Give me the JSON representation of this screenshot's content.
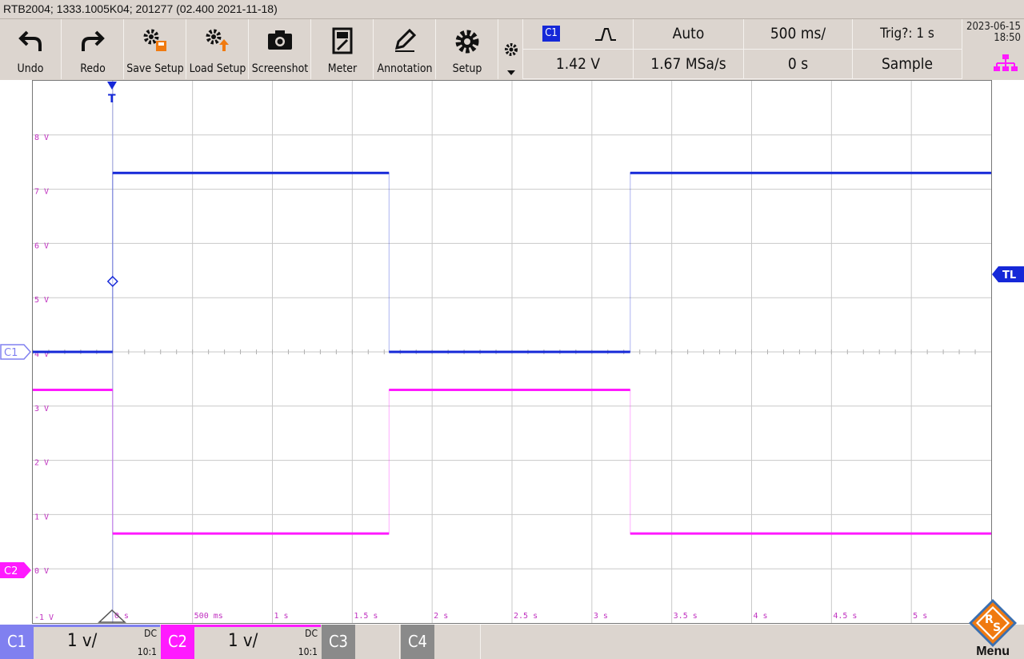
{
  "title": "RTB2004; 1333.1005K04; 201277 (02.400 2021-11-18)",
  "toolbar": {
    "undo": "Undo",
    "redo": "Redo",
    "save_setup": "Save Setup",
    "load_setup": "Load Setup",
    "screenshot": "Screenshot",
    "meter": "Meter",
    "annotation": "Annotation",
    "setup": "Setup"
  },
  "trigger": {
    "source": "C1",
    "level": "1.42 V",
    "mode": "Auto",
    "sample_rate": "1.67 MSa/s",
    "timebase": "500 ms/",
    "position": "0 s",
    "status": "Trig?: 1 s",
    "acquisition": "Sample"
  },
  "datetime": {
    "date": "2023-06-15",
    "time": "18:50"
  },
  "markers": {
    "trigger": "T",
    "trigger_level": "TL",
    "c1": "C1",
    "c2": "C2"
  },
  "colors": {
    "c1": "#1528d8",
    "c2": "#ff1aff",
    "grid": "#c9c9c9",
    "axis_label": "#c030c0",
    "c1_tag": "#8080f0"
  },
  "channels": [
    {
      "name": "C1",
      "scale": "1 v/",
      "coupling": "DC",
      "probe": "10:1",
      "active": true
    },
    {
      "name": "C2",
      "scale": "1 v/",
      "coupling": "DC",
      "probe": "10:1",
      "active": true
    },
    {
      "name": "C3",
      "active": false
    },
    {
      "name": "C4",
      "active": false
    }
  ],
  "menu_label": "Menu",
  "chart_data": {
    "type": "line",
    "x_tick_labels": [
      "0 s",
      "500 ms",
      "1 s",
      "1.5 s",
      "2 s",
      "2.5 s",
      "3 s",
      "3.5 s",
      "4 s",
      "4.5 s",
      "5 s"
    ],
    "y_tick_labels": [
      "-1 V",
      "0 V",
      "1 V",
      "2 V",
      "3 V",
      "4 V",
      "5 V",
      "6 V",
      "7 V",
      "8 V"
    ],
    "xlim": [
      -0.5,
      5.5
    ],
    "ylim": [
      -1,
      9
    ],
    "grid": true,
    "series": [
      {
        "name": "C1",
        "color": "#1528d8",
        "x": [
          -0.5,
          0.0,
          0.0,
          1.73,
          1.73,
          3.24,
          3.24,
          5.5
        ],
        "y": [
          4.0,
          4.0,
          7.3,
          7.3,
          4.0,
          4.0,
          7.3,
          7.3
        ]
      },
      {
        "name": "C2",
        "color": "#ff1aff",
        "x": [
          -0.5,
          0.0,
          0.0,
          1.73,
          1.73,
          3.24,
          3.24,
          5.5
        ],
        "y": [
          3.3,
          3.3,
          0.65,
          0.65,
          3.3,
          3.3,
          0.65,
          0.65
        ]
      }
    ]
  }
}
